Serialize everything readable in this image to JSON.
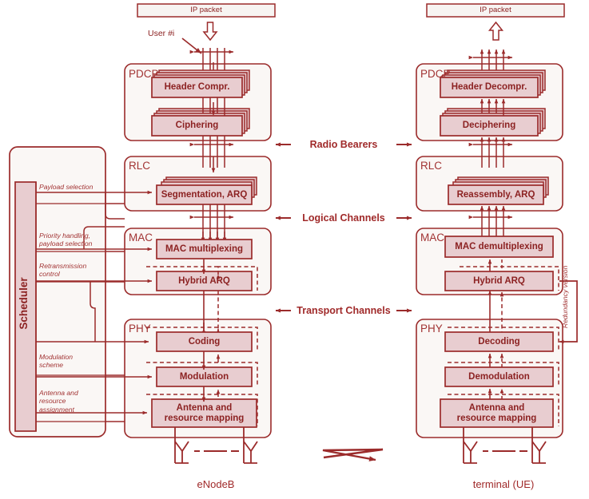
{
  "diagram": {
    "title": "LTE radio protocol architecture: eNodeB downlink transmitter and terminal (UE) receiver",
    "colors": {
      "line": "#9b2b2b",
      "box_fill": "#e8cdd0",
      "panel_fill": "#faf7f5",
      "text": "#8c2222",
      "bearer_line": "#a33434"
    }
  },
  "top": {
    "left_ip_packet": "IP packet",
    "right_ip_packet": "IP packet",
    "user_label": "User #i"
  },
  "enodeb": {
    "node_label": "eNodeB",
    "layers": [
      {
        "name": "PDCP",
        "blocks": [
          "Header Compr.",
          "Ciphering"
        ]
      },
      {
        "name": "RLC",
        "blocks": [
          "Segmentation, ARQ"
        ]
      },
      {
        "name": "MAC",
        "blocks": [
          "MAC multiplexing",
          "Hybrid ARQ"
        ]
      },
      {
        "name": "PHY",
        "blocks": [
          "Coding",
          "Modulation",
          "Antenna and\nresource mapping"
        ]
      }
    ]
  },
  "ue": {
    "node_label": "terminal (UE)",
    "layers": [
      {
        "name": "PDCP",
        "blocks": [
          "Header Decompr.",
          "Deciphering"
        ]
      },
      {
        "name": "RLC",
        "blocks": [
          "Reassembly, ARQ"
        ]
      },
      {
        "name": "MAC",
        "blocks": [
          "MAC demultiplexing",
          "Hybrid ARQ"
        ]
      },
      {
        "name": "PHY",
        "blocks": [
          "Decoding",
          "Demodulation",
          "Antenna and\nresource mapping"
        ]
      }
    ],
    "redundancy_version": "Redundancy\nversion"
  },
  "interfaces": [
    {
      "label": "Radio Bearers"
    },
    {
      "label": "Logical Channels"
    },
    {
      "label": "Transport Channels"
    }
  ],
  "scheduler": {
    "title": "Scheduler",
    "features": [
      "Payload selection",
      "Priority handling,\npayload selection",
      "Retransmission\ncontrol",
      "Modulation\nscheme",
      "Antenna and\nresource\nassignment"
    ]
  }
}
